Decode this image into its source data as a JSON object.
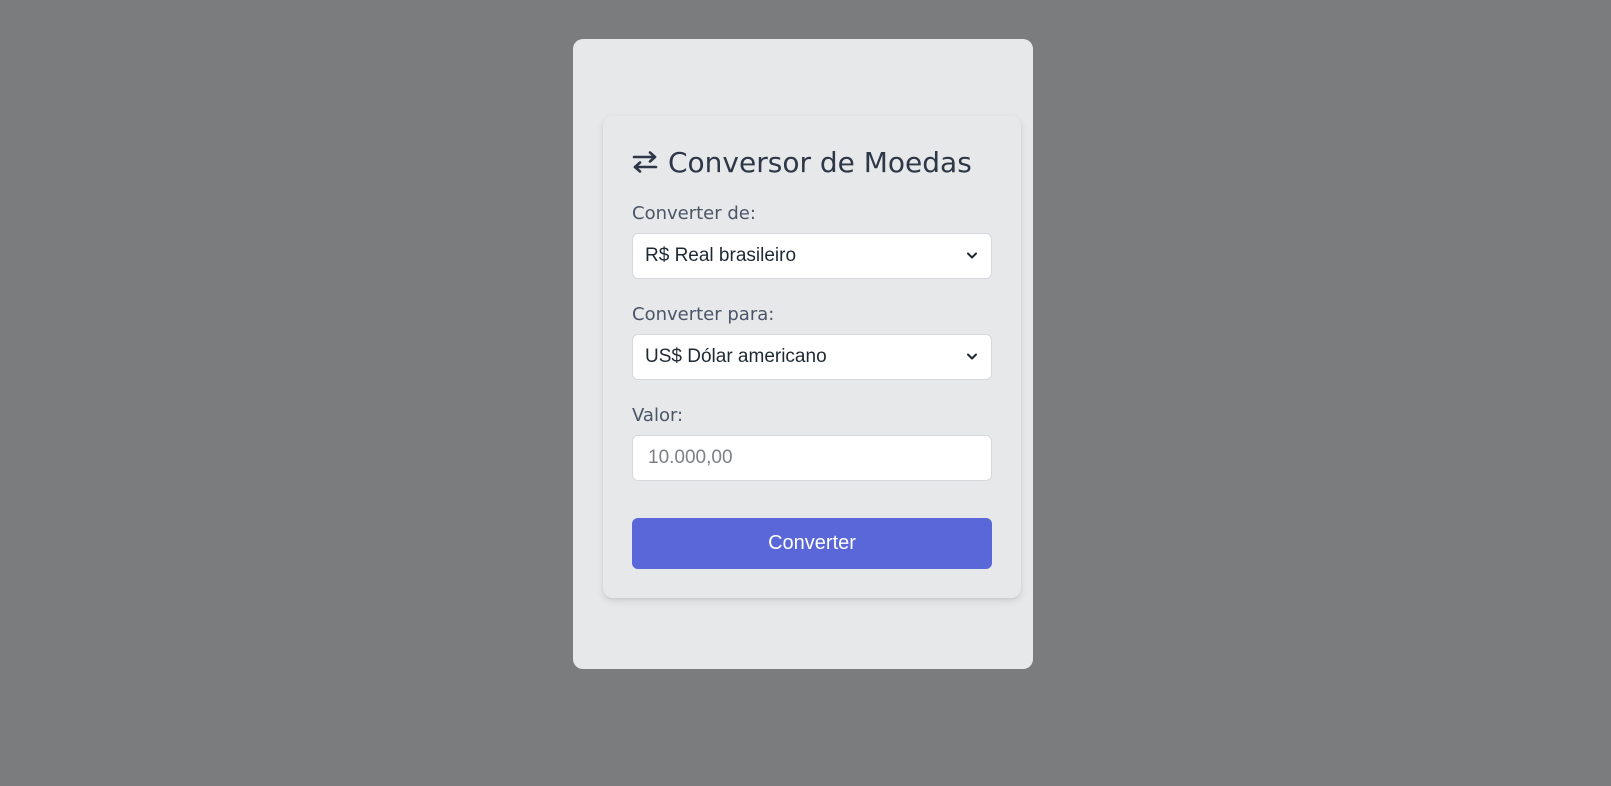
{
  "converter": {
    "title": "Conversor de Moedas",
    "title_icon": "exchange-arrows-icon",
    "from_label": "Converter de:",
    "from_value": "R$ Real brasileiro",
    "to_label": "Converter para:",
    "to_value": "US$ Dólar americano",
    "amount_label": "Valor:",
    "amount_placeholder": "10.000,00",
    "amount_value": "",
    "button_label": "Converter"
  },
  "colors": {
    "page_background": "#7b7c7e",
    "card_background": "#e7e8ea",
    "title_text": "#2d3748",
    "label_text": "#4a5568",
    "button_background": "#5a67d8",
    "button_text": "#ffffff"
  }
}
